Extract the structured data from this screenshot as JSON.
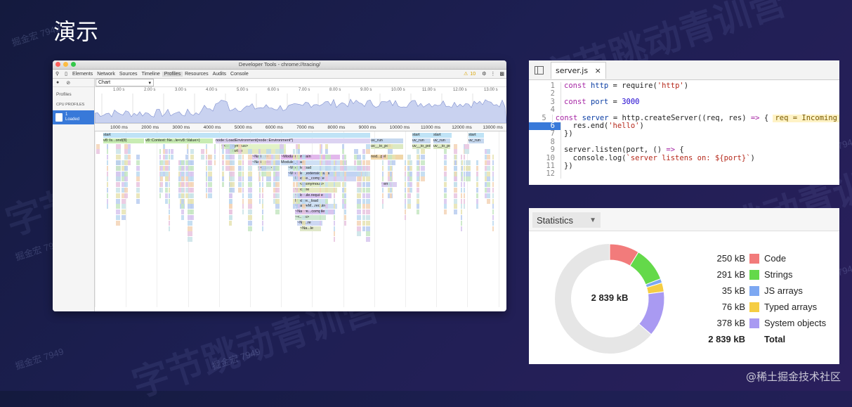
{
  "slide": {
    "title": "演示",
    "footer": "@稀土掘金技术社区",
    "watermark_big": "字节跳动青训营",
    "watermark_small": "掘金宏 7949"
  },
  "devtools": {
    "window_title": "Developer Tools - chrome://tracing/",
    "tabs": [
      "Elements",
      "Network",
      "Sources",
      "Timeline",
      "Profiles",
      "Resources",
      "Audits",
      "Console"
    ],
    "active_tab": "Profiles",
    "warning_count": "10",
    "sidebar": {
      "profiles_label": "Profiles",
      "cpu_profiles_label": "CPU PROFILES",
      "profile_item_name": "1",
      "profile_item_status": "Loaded"
    },
    "view_select": "Chart",
    "overview_ticks": [
      "1.00 s",
      "2.00 s",
      "3.00 s",
      "4.00 s",
      "5.00 s",
      "6.00 s",
      "7.00 s",
      "8.00 s",
      "9.00 s",
      "10.00 s",
      "11.00 s",
      "12.00 s",
      "13.00 s"
    ],
    "detail_ticks": [
      "1000 ms",
      "2000 ms",
      "3000 ms",
      "4000 ms",
      "5000 ms",
      "6000 ms",
      "7000 ms",
      "8000 ms",
      "9000 ms",
      "10000 ms",
      "11000 ms",
      "12000 ms",
      "13000 ms"
    ],
    "flame_labels": {
      "start": "start",
      "row1_a": "v8::Is...ond(8)",
      "row1_b": "v8::Context::Ne...le<v8::Value>)",
      "row1_c": "node::LoadEnvironment(node::Environment*)",
      "row1_d": "uv_run",
      "row2_a": "~<anonymous>",
      "row2_b": "uv__io_poll",
      "row3_a": "~startup",
      "row4_a": "~Nati...ire",
      "row4_b": "~Module.runMain",
      "row5_a": "~Nati...pile",
      "row5_b": "Module._load",
      "row6_a": "~<...us>",
      "row6_b": "~Module.load",
      "row7_b": "~Module._extensions..js",
      "row8_b": "~Module._compile",
      "row9_b": "~<anonymous>",
      "row10_b": "~require",
      "row11_b": "~Module.require",
      "row12_b": "Module._load",
      "row13_b": "~NativeM...require",
      "row14_b": "~Native...compile",
      "row15_b": "~<...us>",
      "row16_b": "~Na...re",
      "row17_b": "~Na...le",
      "emit": "~emit",
      "node_pel": "nod...pel"
    }
  },
  "code": {
    "filename": "server.js",
    "close": "×",
    "highlight_line": 6,
    "inline_hint": "req = Incoming",
    "lines": [
      {
        "n": "1",
        "t": [
          [
            "kw",
            "const "
          ],
          [
            "id",
            "http"
          ],
          [
            "pl",
            " = require("
          ],
          [
            "str",
            "'http'"
          ],
          [
            "pl",
            ")"
          ]
        ]
      },
      {
        "n": "2",
        "t": []
      },
      {
        "n": "3",
        "t": [
          [
            "kw",
            "const "
          ],
          [
            "id",
            "port"
          ],
          [
            "pl",
            " = "
          ],
          [
            "num",
            "3000"
          ]
        ]
      },
      {
        "n": "4",
        "t": []
      },
      {
        "n": "5",
        "t": [
          [
            "kw",
            "const "
          ],
          [
            "id",
            "server"
          ],
          [
            "pl",
            " = http.createServer((req, res) "
          ],
          [
            "kw",
            "=> "
          ],
          [
            "pl",
            "{ "
          ]
        ]
      },
      {
        "n": "6",
        "t": [
          [
            "pl",
            "  res.end("
          ],
          [
            "str",
            "'hello'"
          ],
          [
            "pl",
            ")"
          ]
        ]
      },
      {
        "n": "7",
        "t": [
          [
            "pl",
            "})"
          ]
        ]
      },
      {
        "n": "8",
        "t": []
      },
      {
        "n": "9",
        "t": [
          [
            "pl",
            "server.listen(port, () "
          ],
          [
            "kw",
            "=> "
          ],
          [
            "pl",
            "{"
          ]
        ]
      },
      {
        "n": "10",
        "t": [
          [
            "pl",
            "  console.log("
          ],
          [
            "str",
            "`server listens on: ${port}`"
          ],
          [
            "pl",
            ")"
          ]
        ]
      },
      {
        "n": "11",
        "t": [
          [
            "pl",
            "})"
          ]
        ]
      },
      {
        "n": "12",
        "t": []
      }
    ]
  },
  "statistics": {
    "select_label": "Statistics",
    "total_center": "2 839 kB",
    "rows": [
      {
        "value": "250 kB",
        "label": "Code",
        "color": "#f27b7b",
        "kb": 250
      },
      {
        "value": "291 kB",
        "label": "Strings",
        "color": "#64d94a",
        "kb": 291
      },
      {
        "value": "35 kB",
        "label": "JS arrays",
        "color": "#7da8f2",
        "kb": 35
      },
      {
        "value": "76 kB",
        "label": "Typed arrays",
        "color": "#f5cd43",
        "kb": 76
      },
      {
        "value": "378 kB",
        "label": "System objects",
        "color": "#a99af2",
        "kb": 378
      }
    ],
    "total_value": "2 839 kB",
    "total_label": "Total",
    "total_kb": 2839
  }
}
